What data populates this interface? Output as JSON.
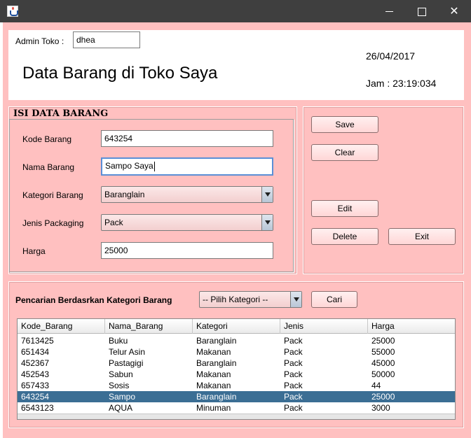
{
  "window": {
    "icon": "java-icon"
  },
  "header": {
    "admin_label": "Admin Toko :",
    "admin_value": "dhea",
    "title": "Data Barang di Toko Saya",
    "date": "26/04/2017",
    "time": "Jam : 23:19:034"
  },
  "form": {
    "section_title": "ISI DATA BARANG",
    "kode_label": "Kode Barang",
    "kode_value": "643254",
    "nama_label": "Nama Barang",
    "nama_value": "Sampo Saya",
    "kategori_label": "Kategori Barang",
    "kategori_value": "Baranglain",
    "jenis_label": "Jenis Packaging",
    "jenis_value": "Pack",
    "harga_label": "Harga",
    "harga_value": "25000"
  },
  "actions": {
    "save": "Save",
    "clear": "Clear",
    "edit": "Edit",
    "delete": "Delete",
    "exit": "Exit"
  },
  "search": {
    "label": "Pencarian Berdasrkan Kategori Barang",
    "category_value": "-- Pilih Kategori --",
    "button": "Cari"
  },
  "table": {
    "columns": [
      "Kode_Barang",
      "Nama_Barang",
      "Kategori",
      "Jenis",
      "Harga"
    ],
    "rows": [
      [
        "7613425",
        "Buku",
        "Baranglain",
        "Pack",
        "25000"
      ],
      [
        "651434",
        "Telur Asin",
        "Makanan",
        "Pack",
        "55000"
      ],
      [
        "452367",
        "Pastagigi",
        "Baranglain",
        "Pack",
        "45000"
      ],
      [
        "452543",
        "Sabun",
        "Makanan",
        "Pack",
        "50000"
      ],
      [
        "657433",
        "Sosis",
        "Makanan",
        "Pack",
        "44"
      ],
      [
        "643254",
        "Sampo",
        "Baranglain",
        "Pack",
        "25000"
      ],
      [
        "6543123",
        "AQUA",
        "Minuman",
        "Pack",
        "3000"
      ]
    ],
    "selected_row": 5
  },
  "colors": {
    "background": "#ffc0c0",
    "selection": "#3b6e94",
    "titlebar": "#3f3f3f"
  }
}
